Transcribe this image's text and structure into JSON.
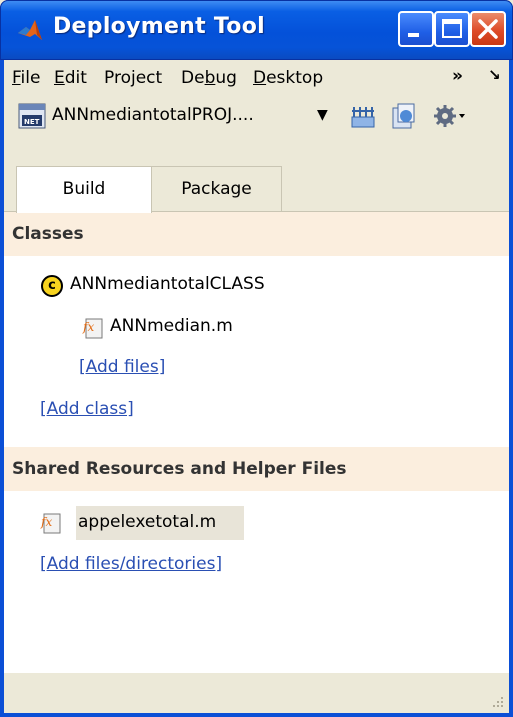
{
  "window": {
    "title": "Deployment Tool"
  },
  "menu": {
    "items": [
      {
        "label": "File",
        "mnemonic": "F"
      },
      {
        "label": "Edit",
        "mnemonic": "E"
      },
      {
        "label": "Project",
        "mnemonic": ""
      },
      {
        "label": "Debug",
        "mnemonic": "b"
      },
      {
        "label": "Desktop",
        "mnemonic": "D"
      }
    ],
    "overflow": "»",
    "dock": "↘"
  },
  "toolbar": {
    "project_name": "ANNmediantotalPROJ....",
    "icons": [
      "build-icon",
      "package-icon",
      "settings-icon"
    ]
  },
  "tabs": [
    {
      "label": "Build"
    },
    {
      "label": "Package"
    }
  ],
  "sections": {
    "classes": {
      "header": "Classes",
      "class_badge": "c",
      "class_name": "ANNmediantotalCLASS",
      "file": "ANNmedian.m",
      "add_files": "[Add files]",
      "add_class": "[Add class]"
    },
    "shared": {
      "header": "Shared Resources and Helper Files",
      "file": "appelexetotal.m",
      "add_files_dirs": "[Add files/directories]"
    }
  },
  "colors": {
    "titlebar": "#0451d9",
    "section_header_bg": "#fbeede",
    "link": "#2a4fb3",
    "class_badge": "#f7d31f"
  }
}
